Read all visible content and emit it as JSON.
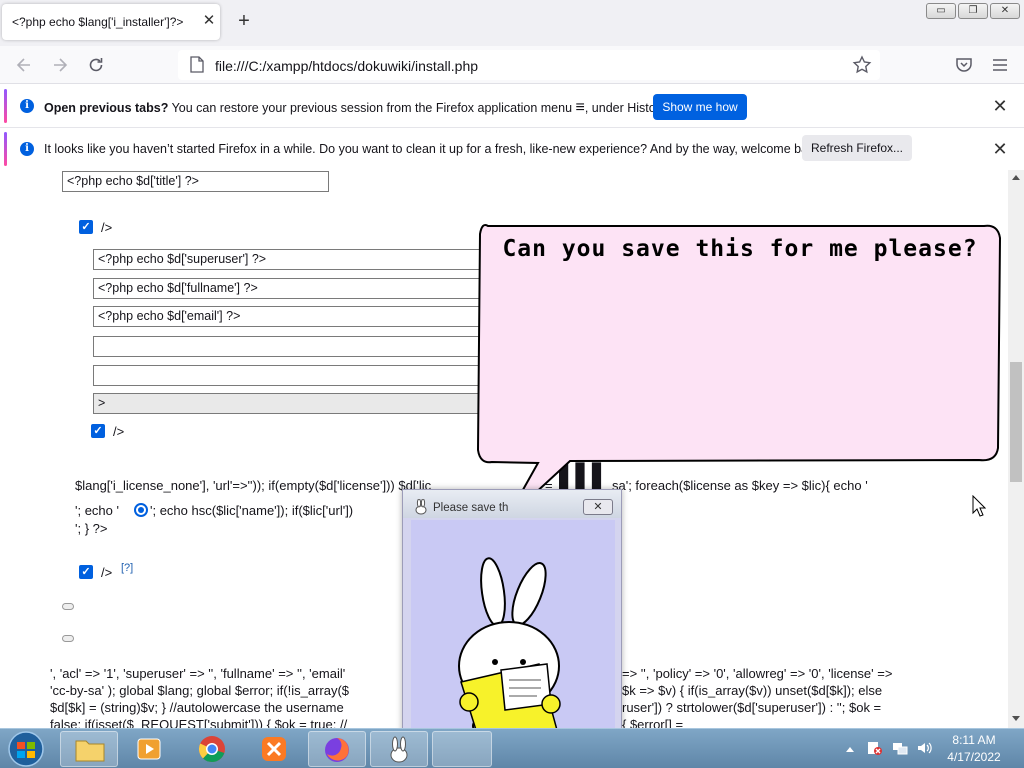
{
  "browser": {
    "tab_title": "<?php echo $lang['i_installer']?>",
    "tab_close": "✕",
    "new_tab": "+",
    "url": "file:///C:/xampp/htdocs/dokuwiki/install.php",
    "win_minimize": "▭",
    "win_restore": "❐",
    "win_close": "✕"
  },
  "notifications": {
    "session": {
      "text_bold": "Open previous tabs?",
      "text": " You can restore your previous session from the Firefox application menu ",
      "menu_glyph": "≡",
      "text_end": ", under History.",
      "button": "Show me how",
      "close": "✕"
    },
    "refresh": {
      "text": "It looks like you haven’t started Firefox in a while. Do you want to clean it up for a fresh, like-new experience? And by the way, welcome back!",
      "button": "Refresh Firefox...",
      "close": "✕"
    }
  },
  "page": {
    "title_field": "<?php echo $d['title'] ?>",
    "acl_suffix": "/>",
    "superuser_field": "<?php echo $d['superuser'] ?>",
    "fullname_field": "<?php echo $d['fullname'] ?>",
    "email_field": "<?php echo $d['email'] ?>",
    "select_text": ">",
    "allowreg_suffix": "/>",
    "license_line1": "$lang['i_license_none'], 'url'=>'')); if(empty($d['license'])) $d['lic",
    "license_line1b": "= ",
    "license_line1c": "sa'; foreach($license as $key => $lic){ echo '",
    "license_line2a": "'; echo '",
    "license_line2b": "'; echo hsc($lic['name']); if($lic['url']) ",
    "license_line3": "'; } ?>",
    "pop_suffix": "/>",
    "help_link": "[?]",
    "code_line1a": "', 'acl' => '1', 'superuser' => '', 'fullname' => '', 'email'",
    "code_line1b": "=> '', 'policy' => '0', 'allowreg' => '0', 'license' =>",
    "code_line2a": "'cc-by-sa' ); global $lang; global $error; if(!is_array($",
    "code_line2b": "$k => $v) { if(is_array($v)) unset($d[$k]); else",
    "code_line3a": "$d[$k] = (string)$v; } //autolowercase the username",
    "code_line3b": "ruser']) ? strtolower($d['superuser']) : ''; $ok =",
    "code_line4a": "false; if(isset($_REQUEST['submit'])) { $ok = true; //",
    "code_line4b": "{ $error[] ="
  },
  "bubble": {
    "text": "Can you save this for me please?"
  },
  "popup": {
    "title": "Please save th",
    "close": "✕"
  },
  "taskbar": {
    "time": "8:11 AM",
    "date": "4/17/2022"
  }
}
